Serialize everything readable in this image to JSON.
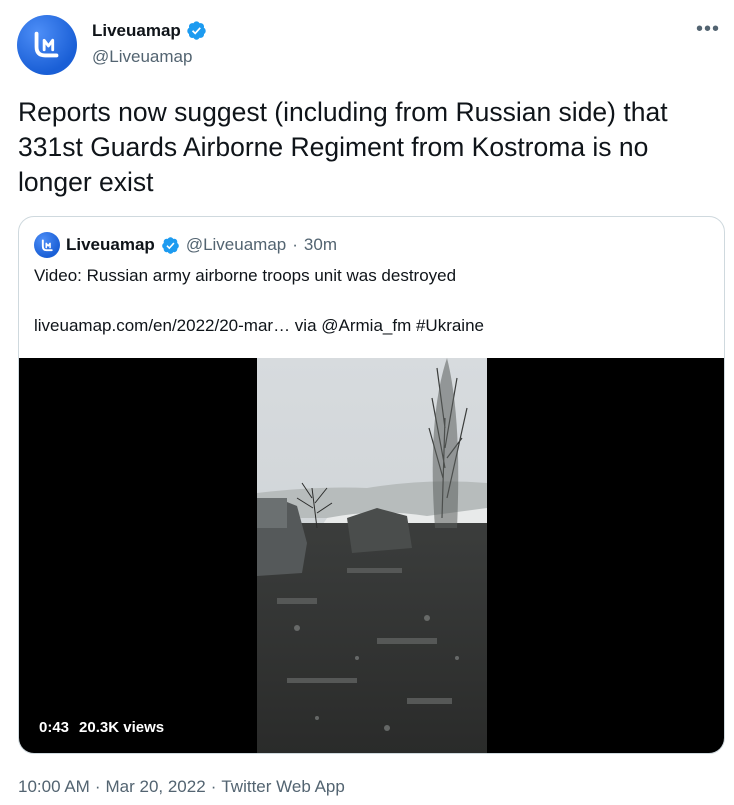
{
  "author": {
    "display_name": "Liveuamap",
    "handle": "@Liveuamap",
    "avatar_icon": "liveuamap-logo-icon",
    "verified_icon": "verified-badge-icon"
  },
  "more_icon": "more-options-icon",
  "tweet": {
    "text": "Reports now suggest (including from Russian side) that 331st Guards Airborne Regiment from Kostroma is no longer exist"
  },
  "quoted": {
    "display_name": "Liveuamap",
    "handle": "@Liveuamap",
    "separator": "·",
    "time": "30m",
    "text_line1": "Video: Russian army airborne troops unit was destroyed",
    "text_line2": "liveuamap.com/en/2022/20-mar… via @Armia_fm #Ukraine",
    "video": {
      "duration": "0:43",
      "views": "20.3K views"
    }
  },
  "footer": {
    "time": "10:00 AM",
    "separator": "·",
    "date": "Mar 20, 2022",
    "separator2": "·",
    "source": "Twitter Web App"
  },
  "colors": {
    "text": "#0f1419",
    "secondary": "#536471",
    "verified": "#1d9bf0",
    "border": "#cfd9de",
    "brand": "#1a5fd6"
  }
}
